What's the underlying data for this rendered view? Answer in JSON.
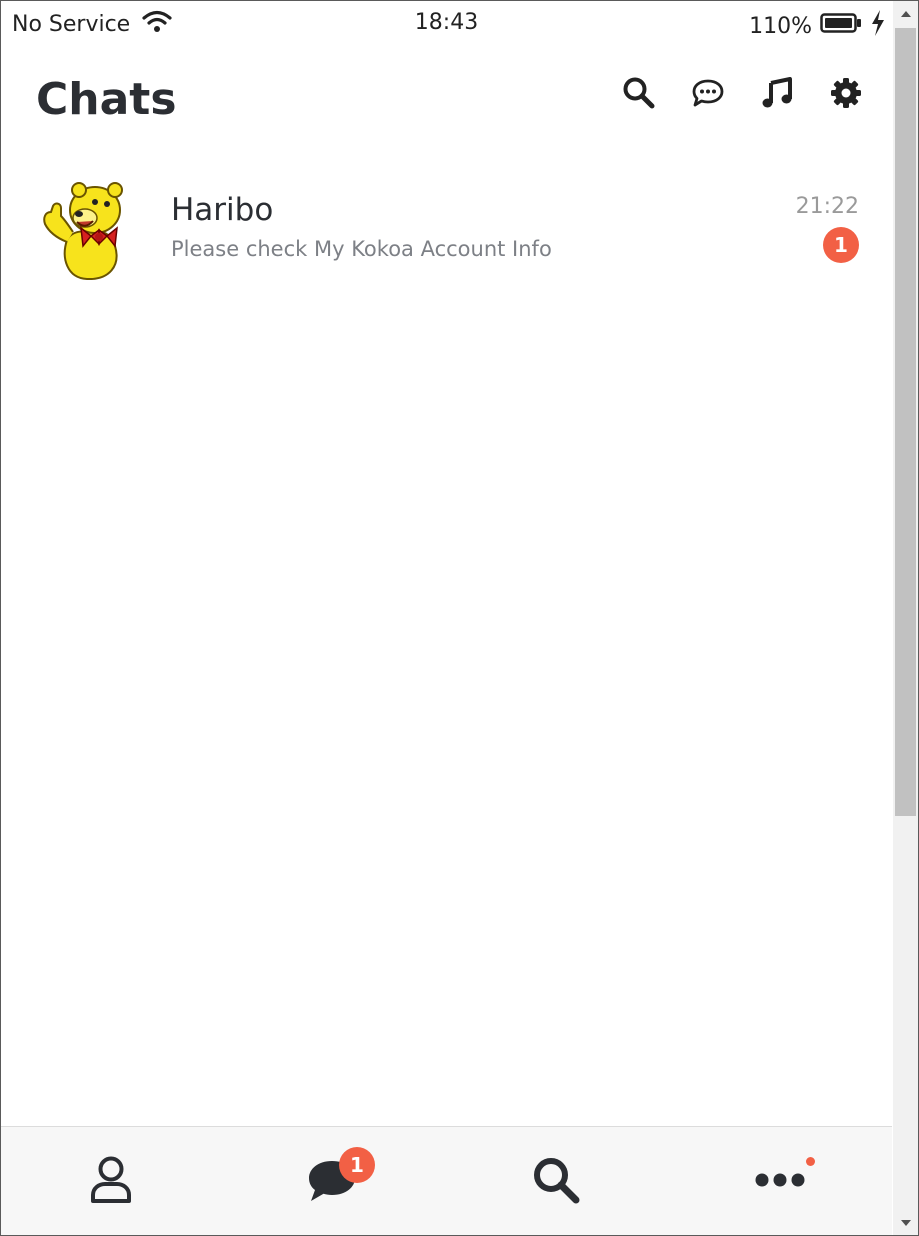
{
  "status_bar": {
    "carrier": "No Service",
    "time": "18:43",
    "battery": "110%"
  },
  "header": {
    "title": "Chats",
    "icons": [
      "search-icon",
      "chat-bubble-icon",
      "music-note-icon",
      "gear-icon"
    ]
  },
  "chats": [
    {
      "name": "Haribo",
      "preview": "Please check My Kokoa Account Info",
      "time": "21:22",
      "unread": "1",
      "avatar": "haribo-bear-avatar"
    }
  ],
  "tab_bar": {
    "tabs": [
      {
        "icon": "person-icon"
      },
      {
        "icon": "chat-icon",
        "badge": "1"
      },
      {
        "icon": "search-icon"
      },
      {
        "icon": "more-icon"
      }
    ]
  },
  "colors": {
    "accent_badge": "#f26045",
    "text_primary": "#2b2e33",
    "text_secondary": "#7d8086",
    "tab_bar_bg": "#f7f7f7"
  }
}
